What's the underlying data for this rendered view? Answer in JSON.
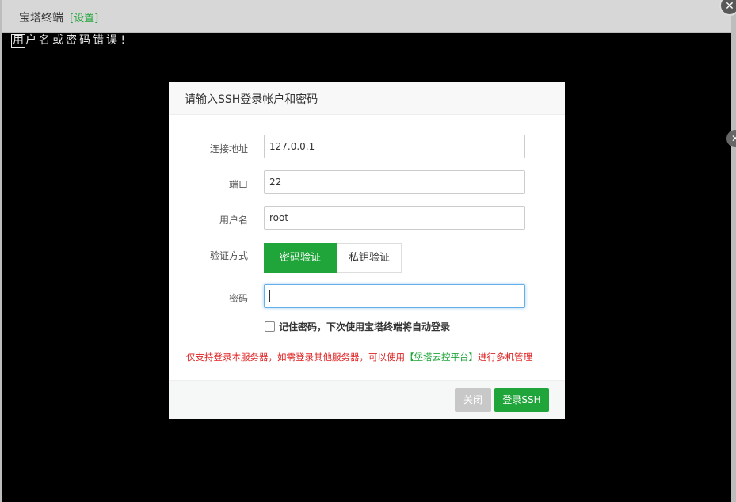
{
  "window": {
    "title": "宝塔终端",
    "settings_link": "[设置]",
    "close_glyph": "✕"
  },
  "terminal": {
    "first_char": "用",
    "rest": "户名或密码错误!"
  },
  "side_close_glyph": "✕",
  "modal": {
    "title": "请输入SSH登录帐户和密码",
    "fields": {
      "host": {
        "label": "连接地址",
        "value": "127.0.0.1"
      },
      "port": {
        "label": "端口",
        "value": "22"
      },
      "user": {
        "label": "用户名",
        "value": "root"
      },
      "auth": {
        "label": "验证方式",
        "password_option": "密码验证",
        "key_option": "私钥验证",
        "selected": "密码验证"
      },
      "password": {
        "label": "密码",
        "value": ""
      }
    },
    "remember": {
      "label": "记住密码，下次使用宝塔终端将自动登录",
      "checked": false
    },
    "notice": {
      "before": "仅支持登录本服务器，如需登录其他服务器，可以使用",
      "link": "【堡塔云控平台】",
      "after": "进行多机管理"
    },
    "buttons": {
      "close": "关闭",
      "login": "登录SSH"
    }
  },
  "colors": {
    "accent": "#20a53a",
    "warning": "#e02020",
    "disabled": "#c8c8c8"
  }
}
